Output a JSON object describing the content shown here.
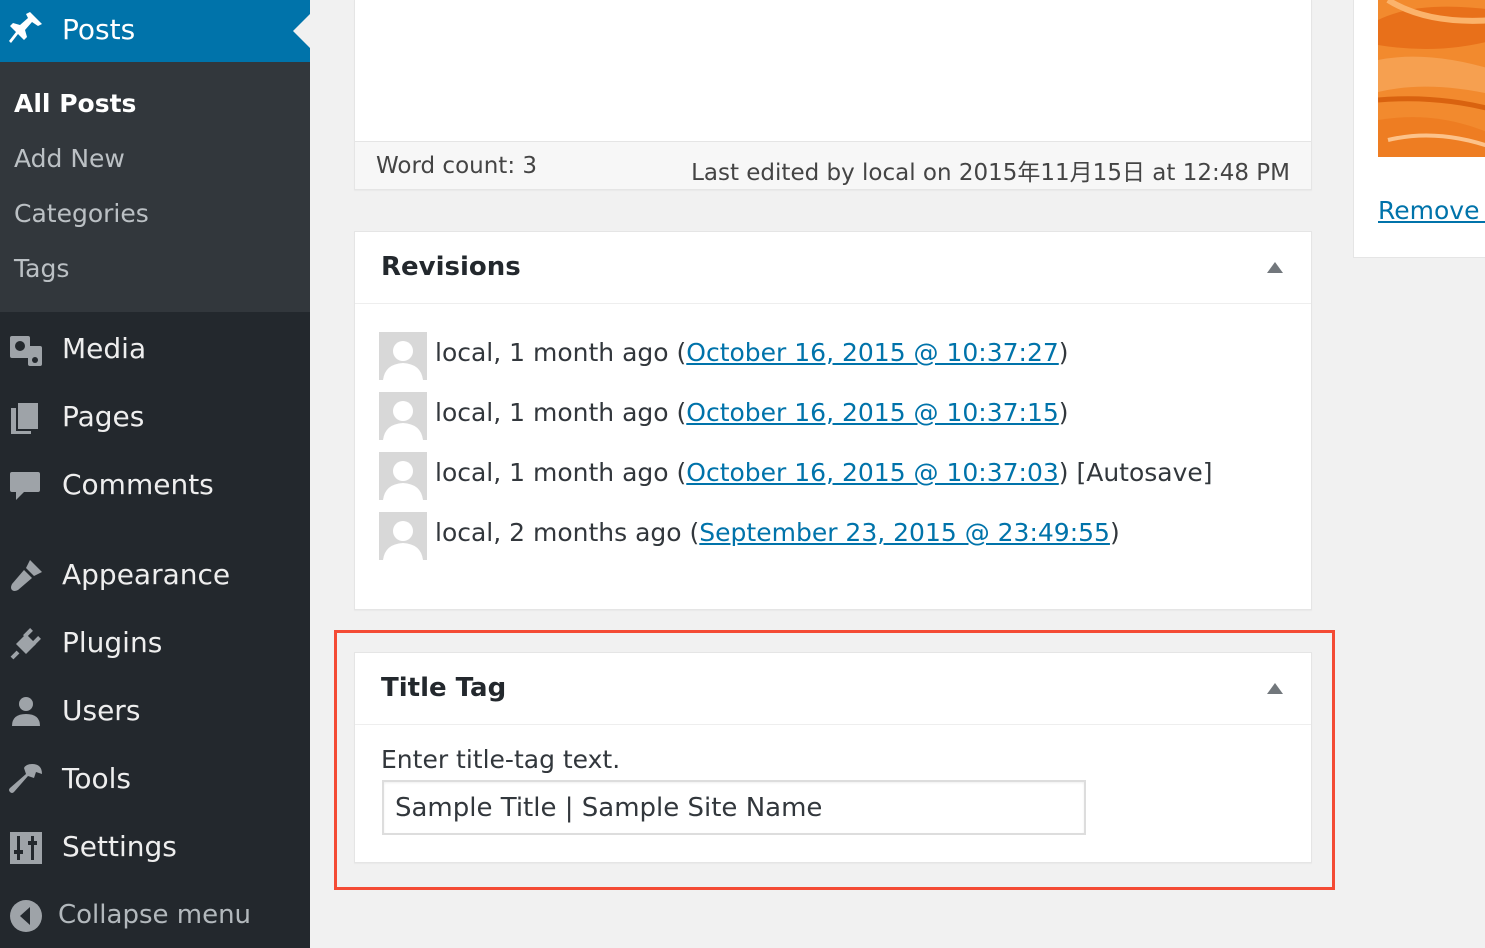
{
  "sidebar": {
    "current": {
      "label": "Posts",
      "icon": "pushpin-icon"
    },
    "submenu": [
      {
        "label": "All Posts",
        "current": true
      },
      {
        "label": "Add New"
      },
      {
        "label": "Categories"
      },
      {
        "label": "Tags"
      }
    ],
    "items": [
      {
        "label": "Media",
        "icon": "media-icon"
      },
      {
        "label": "Pages",
        "icon": "pages-icon"
      },
      {
        "label": "Comments",
        "icon": "comments-icon"
      },
      {
        "label": "Appearance",
        "icon": "appearance-icon"
      },
      {
        "label": "Plugins",
        "icon": "plugins-icon"
      },
      {
        "label": "Users",
        "icon": "users-icon"
      },
      {
        "label": "Tools",
        "icon": "tools-icon"
      },
      {
        "label": "Settings",
        "icon": "settings-icon"
      }
    ],
    "collapse_label": "Collapse menu"
  },
  "editor": {
    "word_count": "Word count: 3",
    "last_edited": "Last edited by local on 2015年11月15日 at 12:48 PM"
  },
  "revisions": {
    "title": "Revisions",
    "items": [
      {
        "prefix": "local, 1 month ago (",
        "link": "October 16, 2015 @ 10:37:27",
        "suffix": ")"
      },
      {
        "prefix": "local, 1 month ago (",
        "link": "October 16, 2015 @ 10:37:15",
        "suffix": ")"
      },
      {
        "prefix": "local, 1 month ago (",
        "link": "October 16, 2015 @ 10:37:03",
        "suffix": ") [Autosave]"
      },
      {
        "prefix": "local, 2 months ago (",
        "link": "September 23, 2015 @ 23:49:55",
        "suffix": ")"
      }
    ]
  },
  "title_tag": {
    "title": "Title Tag",
    "label": "Enter title-tag text.",
    "value": "Sample Title | Sample Site Name"
  },
  "featured_image": {
    "remove_label": "Remove f"
  },
  "colors": {
    "sidebar_bg": "#23282d",
    "submenu_bg": "#32373c",
    "accent": "#0073aa",
    "highlight": "#f44b35"
  }
}
